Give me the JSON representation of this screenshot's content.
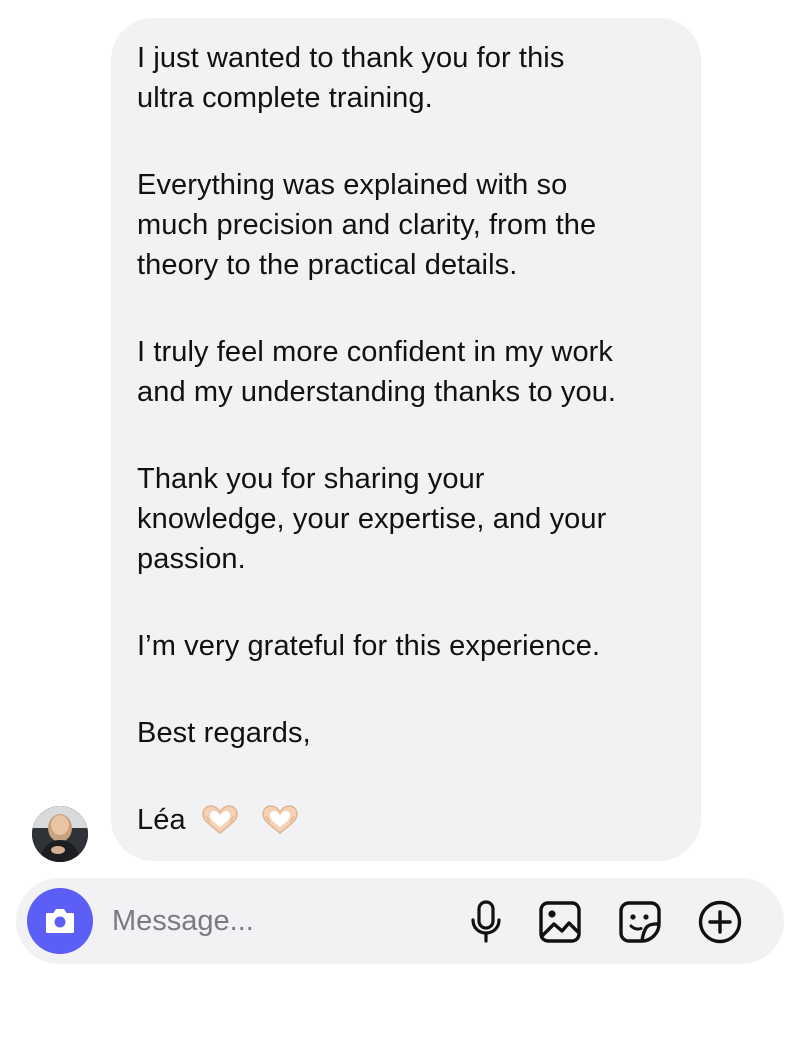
{
  "message": {
    "paragraphs": [
      "I just wanted to thank you for this\nultra complete training.",
      "Everything was explained with so\nmuch precision and clarity, from the\ntheory to the practical details.",
      "I truly feel more confident in my work\nand my understanding thanks to you.",
      "Thank you for sharing your\nknowledge, your expertise, and your\npassion.",
      "I’m very grateful for this experience.",
      "Best regards,"
    ],
    "signature": "Léa",
    "signature_emoji": [
      "heart-hands-emoji",
      "heart-hands-emoji"
    ]
  },
  "sender": {
    "avatar": "sender-avatar"
  },
  "composer": {
    "placeholder": "Message...",
    "icons": [
      "camera-icon",
      "microphone-icon",
      "gallery-icon",
      "sticker-icon",
      "plus-icon"
    ],
    "accent_color": "#5b5ff6"
  }
}
